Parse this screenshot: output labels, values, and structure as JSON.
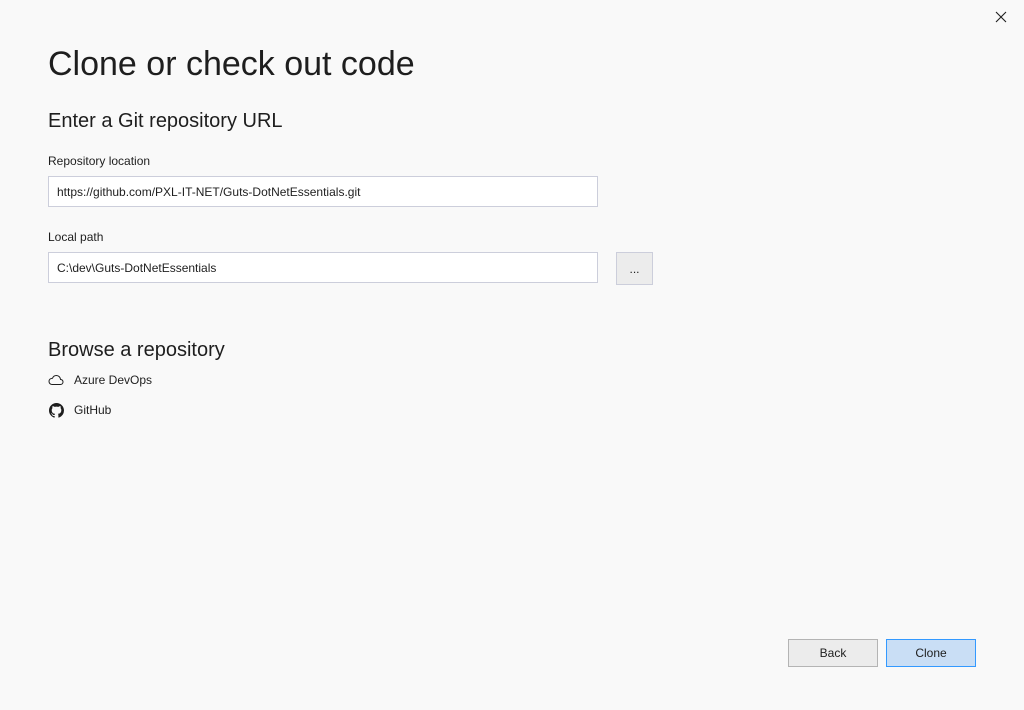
{
  "dialog": {
    "title": "Clone or check out code",
    "close_icon": "close-icon"
  },
  "url_section": {
    "heading": "Enter a Git repository URL",
    "repository_label": "Repository location",
    "repository_value": "https://github.com/PXL-IT-NET/Guts-DotNetEssentials.git",
    "local_path_label": "Local path",
    "local_path_value": "C:\\dev\\Guts-DotNetEssentials",
    "browse_label": "..."
  },
  "browse_section": {
    "heading": "Browse a repository",
    "items": [
      {
        "label": "Azure DevOps",
        "icon": "cloud-icon"
      },
      {
        "label": "GitHub",
        "icon": "github-icon"
      }
    ]
  },
  "footer": {
    "back_label": "Back",
    "clone_label": "Clone"
  }
}
